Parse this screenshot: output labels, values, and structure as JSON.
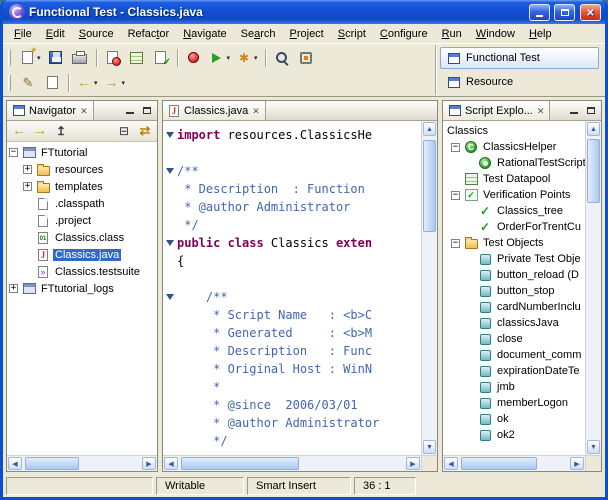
{
  "window": {
    "title": "Functional Test - Classics.java"
  },
  "menu": {
    "items": [
      {
        "label": "File",
        "accel": 0
      },
      {
        "label": "Edit",
        "accel": 0
      },
      {
        "label": "Source",
        "accel": 0
      },
      {
        "label": "Refactor",
        "accel": 5
      },
      {
        "label": "Navigate",
        "accel": 0
      },
      {
        "label": "Search",
        "accel": 2
      },
      {
        "label": "Project",
        "accel": 0
      },
      {
        "label": "Script",
        "accel": 0
      },
      {
        "label": "Configure",
        "accel": 0
      },
      {
        "label": "Run",
        "accel": 0
      },
      {
        "label": "Window",
        "accel": 0
      },
      {
        "label": "Help",
        "accel": 0
      }
    ]
  },
  "toolbar": {
    "row1": [
      {
        "name": "new-wizard",
        "icon": "new",
        "dropdown": true
      },
      {
        "name": "save",
        "icon": "save"
      },
      {
        "name": "print",
        "icon": "print"
      },
      {
        "sep": true
      },
      {
        "name": "new-test-script",
        "icon": "page-record"
      },
      {
        "name": "new-datapool",
        "icon": "datapool"
      },
      {
        "name": "new-verification-point",
        "icon": "page-check"
      },
      {
        "sep": true
      },
      {
        "name": "record-script",
        "icon": "record"
      },
      {
        "name": "run-script",
        "icon": "play",
        "dropdown": true
      },
      {
        "name": "external-tools",
        "icon": "star",
        "dropdown": true
      },
      {
        "sep": true
      },
      {
        "name": "search",
        "icon": "search"
      },
      {
        "name": "test-object-inspector",
        "icon": "inspector"
      }
    ],
    "row2": [
      {
        "name": "last-edit-location",
        "icon": "pencil"
      },
      {
        "name": "open-type",
        "icon": "page"
      },
      {
        "sep": true
      },
      {
        "name": "back",
        "icon": "back",
        "dropdown": true
      },
      {
        "name": "forward",
        "icon": "forward",
        "dropdown": true
      }
    ]
  },
  "perspectives": {
    "items": [
      {
        "label": "Functional Test",
        "active": true
      },
      {
        "label": "Resource",
        "active": false
      }
    ]
  },
  "navigator": {
    "title": "Navigator",
    "toolbar": [
      {
        "name": "back",
        "icon": "back"
      },
      {
        "name": "forward",
        "icon": "forward"
      },
      {
        "name": "up",
        "icon": "up"
      },
      {
        "name": "collapse-all",
        "icon": "collapse"
      },
      {
        "name": "link-with-editor",
        "icon": "link"
      }
    ],
    "tree": [
      {
        "label": "FTtutorial",
        "level": 0,
        "icon": "project",
        "expander": "minus"
      },
      {
        "label": "resources",
        "level": 1,
        "icon": "folder",
        "expander": "plus"
      },
      {
        "label": "templates",
        "level": 1,
        "icon": "folder",
        "expander": "plus"
      },
      {
        "label": ".classpath",
        "level": 1,
        "icon": "file"
      },
      {
        "label": ".project",
        "level": 1,
        "icon": "file"
      },
      {
        "label": "Classics.class",
        "level": 1,
        "icon": "class-file"
      },
      {
        "label": "Classics.java",
        "level": 1,
        "icon": "java-file",
        "selected": true
      },
      {
        "label": "Classics.testsuite",
        "level": 1,
        "icon": "testsuite"
      },
      {
        "label": "FTtutorial_logs",
        "level": 0,
        "icon": "project",
        "expander": "plus"
      }
    ]
  },
  "editor": {
    "tab": "Classics.java",
    "lines": [
      {
        "fold": true,
        "seg": [
          {
            "c": "k",
            "t": "import"
          },
          {
            "c": "p",
            "t": " resources.ClassicsHe"
          }
        ]
      },
      {
        "seg": []
      },
      {
        "fold": true,
        "seg": [
          {
            "c": "c",
            "t": "/**"
          }
        ]
      },
      {
        "seg": [
          {
            "c": "c",
            "t": " * Description  : Function"
          }
        ]
      },
      {
        "seg": [
          {
            "c": "c",
            "t": " * @author Administrator"
          }
        ]
      },
      {
        "seg": [
          {
            "c": "c",
            "t": " */"
          }
        ]
      },
      {
        "fold": true,
        "seg": [
          {
            "c": "k",
            "t": "public class"
          },
          {
            "c": "p",
            "t": " Classics "
          },
          {
            "c": "k",
            "t": "exten"
          }
        ]
      },
      {
        "seg": [
          {
            "c": "p",
            "t": "{"
          }
        ]
      },
      {
        "seg": []
      },
      {
        "fold": true,
        "seg": [
          {
            "c": "c",
            "t": "    /**"
          }
        ]
      },
      {
        "seg": [
          {
            "c": "c",
            "t": "     * Script Name   : <b>C"
          }
        ]
      },
      {
        "seg": [
          {
            "c": "c",
            "t": "     * Generated     : <b>M"
          }
        ]
      },
      {
        "seg": [
          {
            "c": "c",
            "t": "     * Description   : Func"
          }
        ]
      },
      {
        "seg": [
          {
            "c": "c",
            "t": "     * Original Host : WinN"
          }
        ]
      },
      {
        "seg": [
          {
            "c": "c",
            "t": "     *"
          }
        ]
      },
      {
        "seg": [
          {
            "c": "c",
            "t": "     * @since  2006/03/01"
          }
        ]
      },
      {
        "seg": [
          {
            "c": "c",
            "t": "     * @author Administrator"
          }
        ]
      },
      {
        "seg": [
          {
            "c": "c",
            "t": "     */"
          }
        ]
      }
    ]
  },
  "script_explorer": {
    "title": "Script Explo...",
    "root": "Classics",
    "tree": [
      {
        "label": "ClassicsHelper",
        "level": 0,
        "icon": "helper",
        "expander": "minus"
      },
      {
        "label": "RationalTestScript",
        "level": 1,
        "icon": "script-class"
      },
      {
        "label": "Test Datapool",
        "level": 0,
        "icon": "datapool"
      },
      {
        "label": "Verification Points",
        "level": 0,
        "icon": "vp-group",
        "expander": "minus"
      },
      {
        "label": "Classics_tree",
        "level": 1,
        "icon": "vp"
      },
      {
        "label": "OrderForTrentCu",
        "level": 1,
        "icon": "vp"
      },
      {
        "label": "Test Objects",
        "level": 0,
        "icon": "folder",
        "expander": "minus"
      },
      {
        "label": "Private Test Obje",
        "level": 1,
        "icon": "test-object"
      },
      {
        "label": "button_reload (D",
        "level": 1,
        "icon": "test-object"
      },
      {
        "label": "button_stop",
        "level": 1,
        "icon": "test-object"
      },
      {
        "label": "cardNumberInclu",
        "level": 1,
        "icon": "test-object"
      },
      {
        "label": "classicsJava",
        "level": 1,
        "icon": "test-object"
      },
      {
        "label": "close",
        "level": 1,
        "icon": "test-object"
      },
      {
        "label": "document_comm",
        "level": 1,
        "icon": "test-object"
      },
      {
        "label": "expirationDateTe",
        "level": 1,
        "icon": "test-object"
      },
      {
        "label": "jmb",
        "level": 1,
        "icon": "test-object"
      },
      {
        "label": "memberLogon",
        "level": 1,
        "icon": "test-object"
      },
      {
        "label": "ok",
        "level": 1,
        "icon": "test-object"
      },
      {
        "label": "ok2",
        "level": 1,
        "icon": "test-object"
      }
    ]
  },
  "statusbar": {
    "writable": "Writable",
    "insert_mode": "Smart Insert",
    "caret_position": "36 : 1"
  },
  "colors": {
    "selection": "#316ac5",
    "keyword": "#7f0055",
    "javadoc": "#4265b0",
    "titlebar": "#1150d2",
    "record_red": "#c80000"
  }
}
